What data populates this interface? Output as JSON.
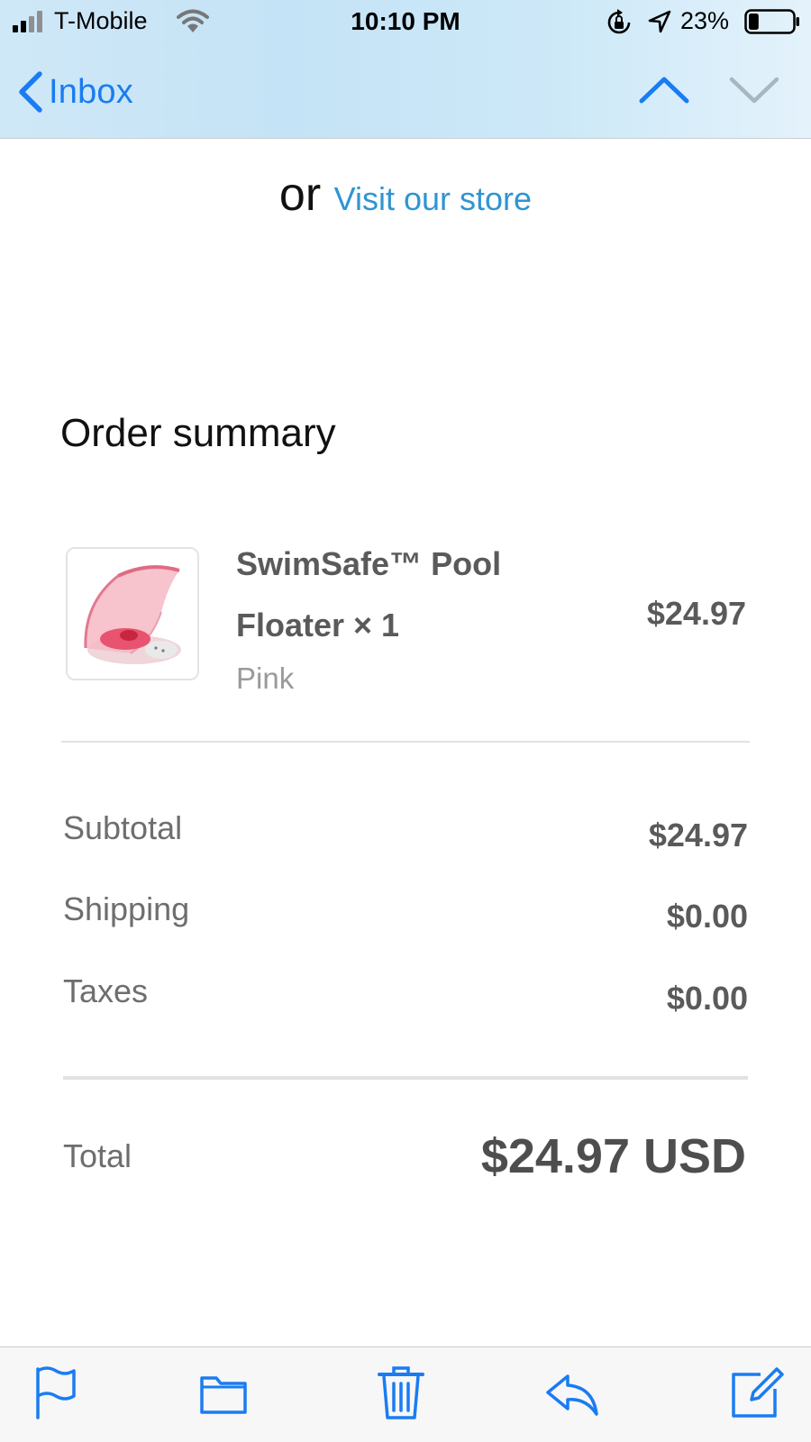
{
  "status_bar": {
    "carrier": "T-Mobile",
    "time": "10:10 PM",
    "battery_percent": "23%",
    "battery_level": 0.23
  },
  "nav": {
    "back_label": "Inbox",
    "icons": [
      "chevron-left-icon",
      "chevron-up-icon",
      "chevron-down-icon"
    ]
  },
  "content": {
    "or_text": "or",
    "store_link": "Visit our store",
    "summary_title": "Order summary",
    "product": {
      "name": "SwimSafe™ Pool Floater × 1",
      "variant": "Pink",
      "price": "$24.97"
    },
    "rows": [
      {
        "label": "Subtotal",
        "value": "$24.97"
      },
      {
        "label": "Shipping",
        "value": "$0.00"
      },
      {
        "label": "Taxes",
        "value": "$0.00"
      }
    ],
    "total_label": "Total",
    "total_value": "$24.97 USD"
  },
  "toolbar": {
    "icons": [
      "flag-icon",
      "folder-icon",
      "trash-icon",
      "reply-icon",
      "compose-icon"
    ]
  },
  "colors": {
    "accent": "#1a7cf2",
    "link": "#2e95d1",
    "text_dark": "#111111",
    "text_gray": "#5a5a5a"
  }
}
